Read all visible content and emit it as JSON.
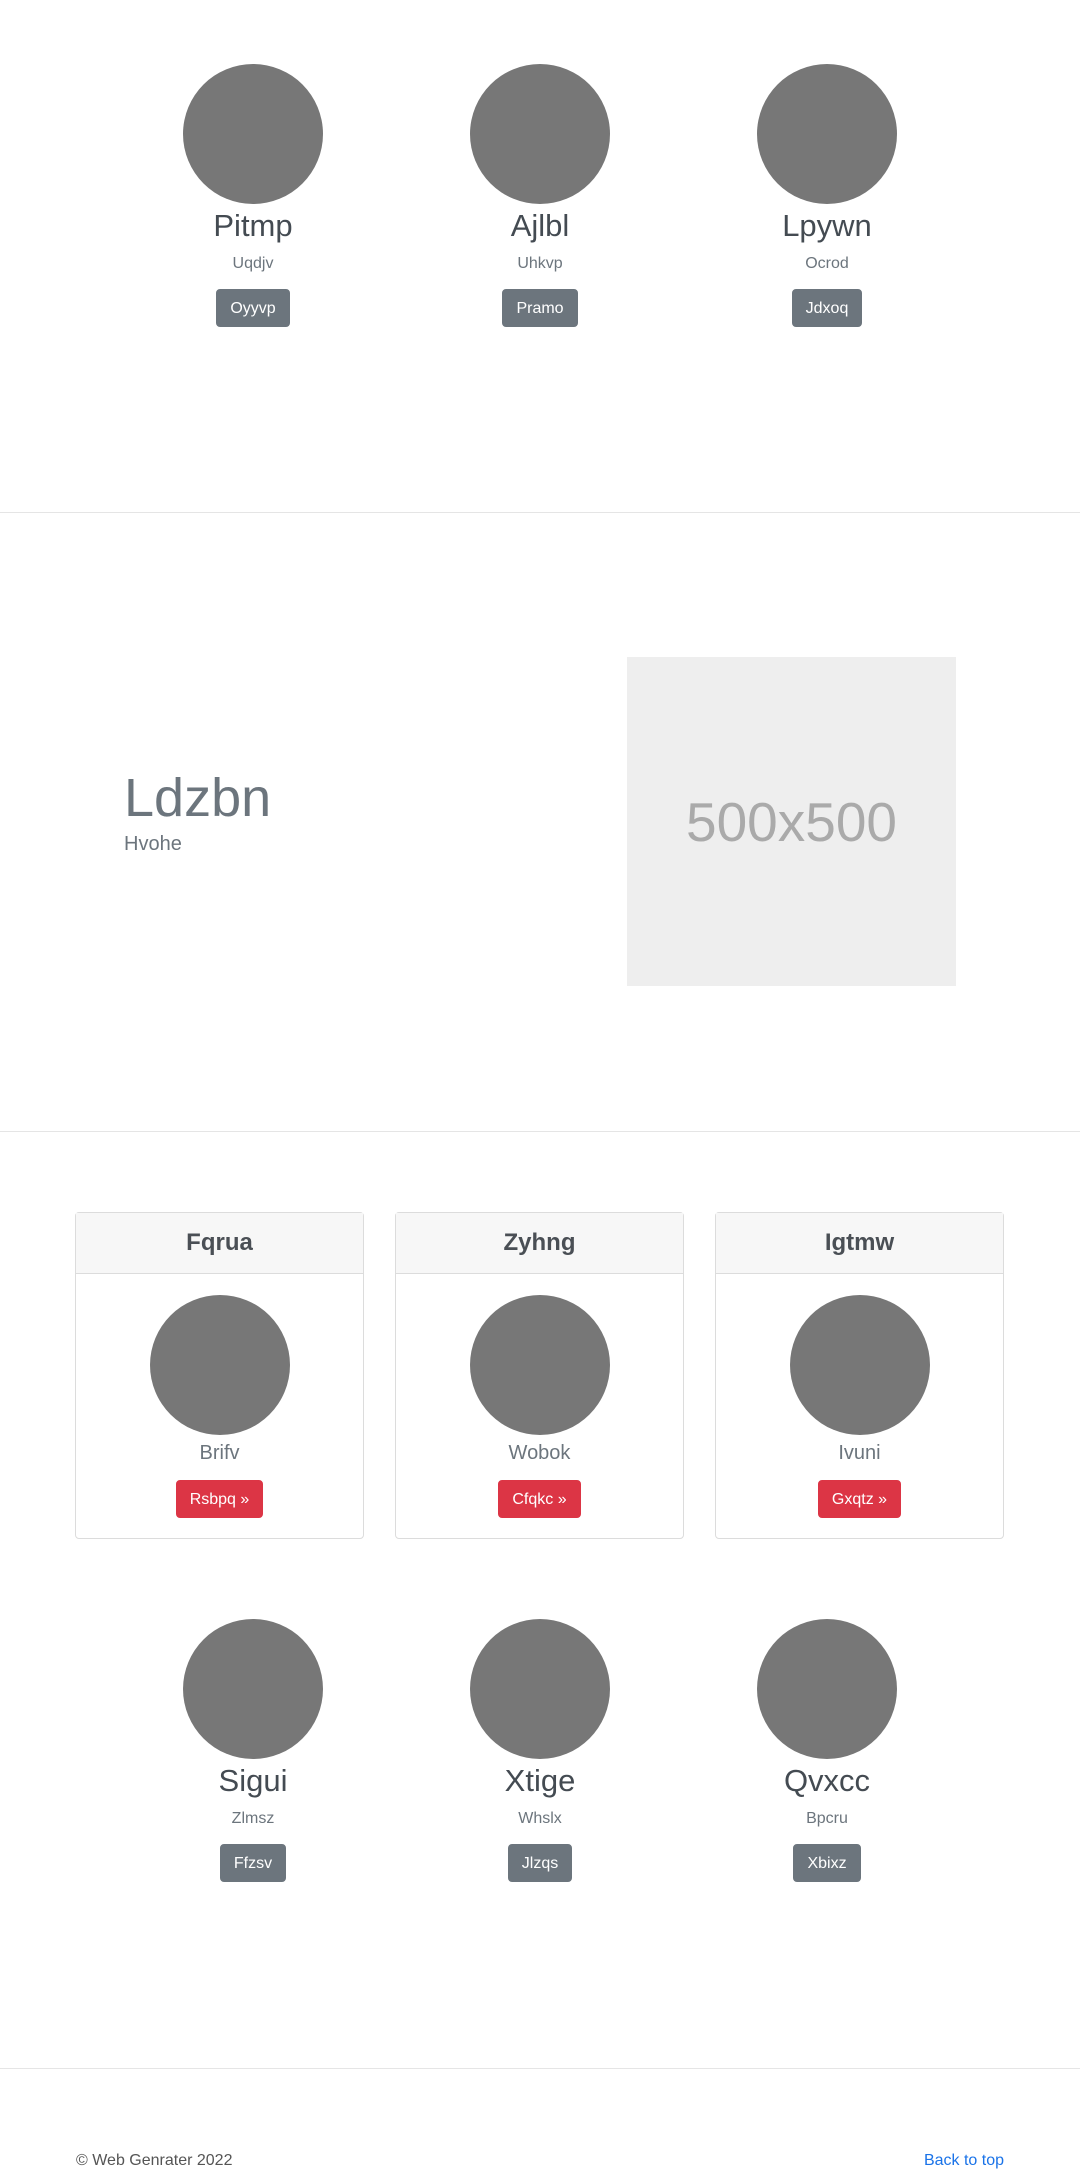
{
  "top_profiles": [
    {
      "name": "Pitmp",
      "sub": "Uqdjv",
      "button": "Oyyvp"
    },
    {
      "name": "Ajlbl",
      "sub": "Uhkvp",
      "button": "Pramo"
    },
    {
      "name": "Lpywn",
      "sub": "Ocrod",
      "button": "Jdxoq"
    }
  ],
  "feature": {
    "title": "Ldzbn",
    "subtitle": "Hvohe",
    "image_placeholder": "500x500"
  },
  "cards": [
    {
      "header": "Fqrua",
      "name": "Brifv",
      "button": "Rsbpq »"
    },
    {
      "header": "Zyhng",
      "name": "Wobok",
      "button": "Cfqkc »"
    },
    {
      "header": "Igtmw",
      "name": "Ivuni",
      "button": "Gxqtz »"
    }
  ],
  "bottom_profiles": [
    {
      "name": "Sigui",
      "sub": "Zlmsz",
      "button": "Ffzsv"
    },
    {
      "name": "Xtige",
      "sub": "Whslx",
      "button": "Jlzqs"
    },
    {
      "name": "Qvxcc",
      "sub": "Bpcru",
      "button": "Xbixz"
    }
  ],
  "footer": {
    "copyright": "© Web Genrater 2022",
    "back_to_top": "Back to top"
  }
}
